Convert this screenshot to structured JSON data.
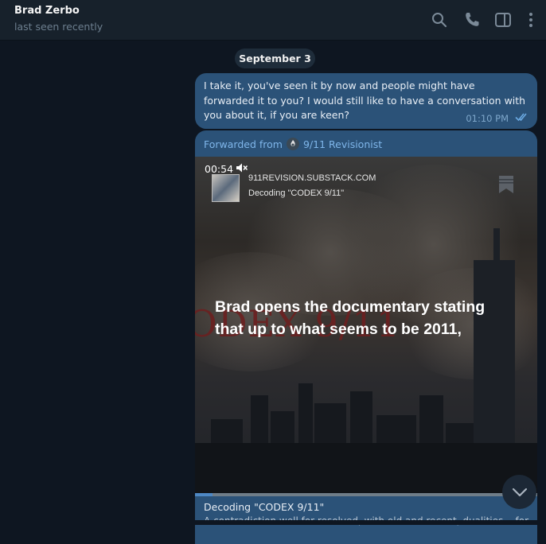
{
  "header": {
    "contact_name": "Brad Zerbo",
    "status": "last seen recently",
    "icons": [
      "search-icon",
      "phone-icon",
      "sidebar-toggle-icon",
      "more-vertical-icon"
    ]
  },
  "chat": {
    "date_separator": "September 3",
    "messages": [
      {
        "text": "I take it, you've seen it by now and people might have forwarded it to you? I would still like to have a conversation with you about it, if you are keen?",
        "time": "01:10 PM",
        "status_icon": "double-check-icon"
      },
      {
        "forwarded_label": "Forwarded from",
        "forwarded_source": "9/11 Revisionist",
        "video": {
          "duration": "00:54",
          "muted": true,
          "site": "911REVISION.SUBSTACK.COM",
          "card_title": "Decoding \"CODEX 9/11\"",
          "background_title": "ODEX 9/11",
          "caption": "Brad opens the documentary stating that up to what seems to be 2011,",
          "progress": 0.05
        },
        "title": "Decoding \"CODEX 9/11\"",
        "preview": "A contradiction well for resolved, with old and recent, dualities... for"
      }
    ]
  },
  "colors": {
    "background": "#0e1621",
    "header": "#17212b",
    "outgoing_bubble": "#2b5278",
    "link": "#7fb6ea"
  }
}
